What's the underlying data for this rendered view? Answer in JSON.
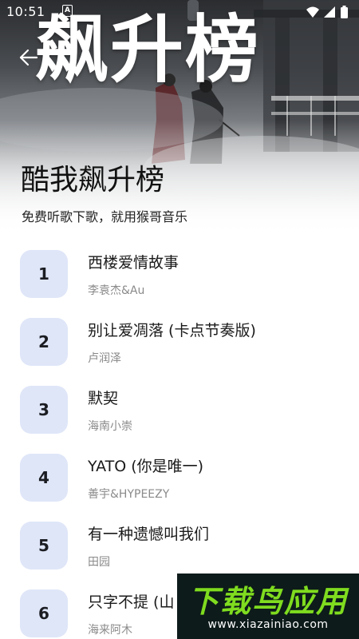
{
  "status_bar": {
    "time": "10:51",
    "notification_glyph": "A"
  },
  "header": {
    "banner_logo": "飙升榜",
    "title": "酷我飙升榜",
    "subtitle": "免费听歌下歌，就用猴哥音乐"
  },
  "songs": [
    {
      "rank": "1",
      "title": "西楼爱情故事",
      "artist": "李袁杰&Au"
    },
    {
      "rank": "2",
      "title": "别让爱凋落 (卡点节奏版)",
      "artist": "卢润泽"
    },
    {
      "rank": "3",
      "title": "默契",
      "artist": "海南小崇"
    },
    {
      "rank": "4",
      "title": "YATO (你是唯一)",
      "artist": "善宇&HYPEEZY"
    },
    {
      "rank": "5",
      "title": "有一种遗憾叫我们",
      "artist": "田园"
    },
    {
      "rank": "6",
      "title": "只字不提 (山",
      "artist": "海来阿木"
    }
  ],
  "watermark": {
    "text": "下载鸟应用",
    "url": "www.xiazainiao.com"
  },
  "colors": {
    "rank_badge_bg": "#dfe6f8",
    "watermark_green": "#7fdc1f"
  }
}
